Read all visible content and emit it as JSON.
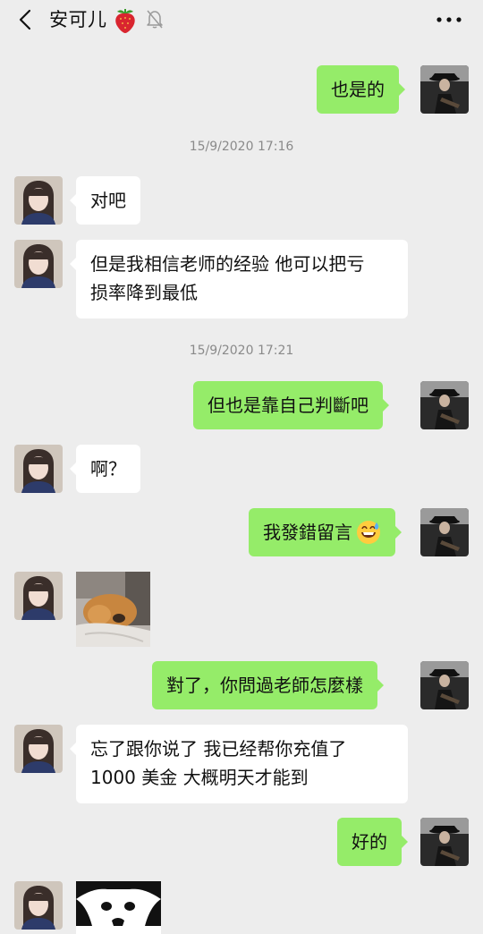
{
  "header": {
    "title": "安可儿"
  },
  "messages": {
    "m1": "也是的",
    "t1": "15/9/2020 17:16",
    "m2": "对吧",
    "m3a": "但是我相信老师的经验 他可以把亏",
    "m3b": "损率降到最低",
    "t2": "15/9/2020 17:21",
    "m4": "但也是靠自己判斷吧",
    "m5": "啊？",
    "m6": "我發錯留言",
    "m8": "對了，你問過老師怎麼樣",
    "m9a": "忘了跟你说了 我已经帮你充值了",
    "m9b": "1000 美金 大概明天才能到",
    "m10": "好的"
  },
  "icons": {
    "back": "chevron-left-icon",
    "strawberry": "strawberry-emoji",
    "mute": "muted-bell-icon",
    "more": "more-dots-icon",
    "emoji": "grinning-sweat-emoji"
  },
  "colors": {
    "background": "#ededed",
    "sent_bubble": "#95ec69",
    "received_bubble": "#ffffff",
    "timestamp": "#8a8a8a"
  }
}
